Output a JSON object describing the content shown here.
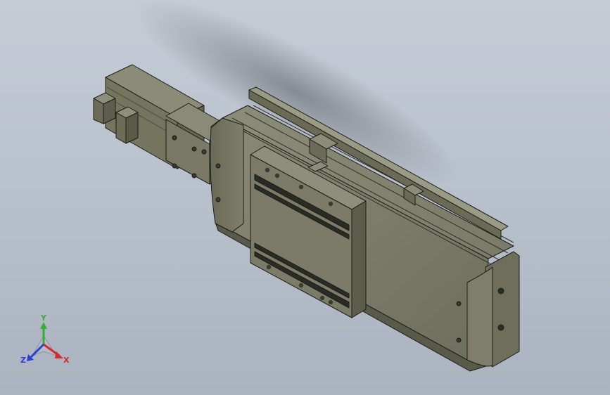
{
  "triad": {
    "x_label": "X",
    "y_label": "Y",
    "z_label": "Z",
    "x_color": "#d42a2a",
    "y_color": "#34b134",
    "z_color": "#2b3fd6"
  },
  "colors": {
    "body_light": "#7f7f6b",
    "body_mid": "#6d6d5b",
    "body_dark": "#55554a",
    "edge": "#1c1c18",
    "slot": "#2a2a26"
  }
}
